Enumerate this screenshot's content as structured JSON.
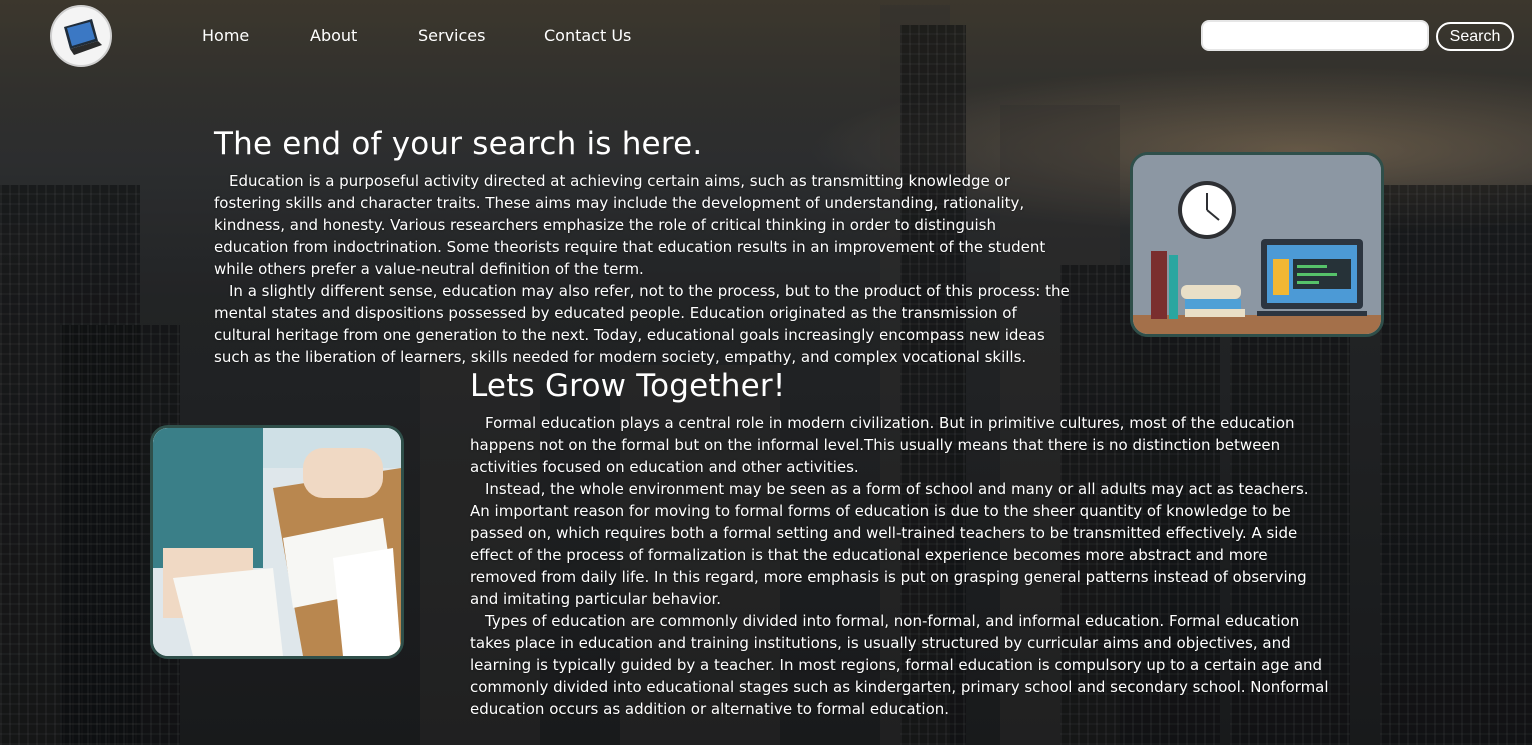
{
  "nav": {
    "logo_alt": "laptop logo",
    "items": [
      "Home",
      "About",
      "Services",
      "Contact Us"
    ]
  },
  "search": {
    "placeholder": "",
    "value": "",
    "button_label": "Search"
  },
  "section1": {
    "title": "The end of your search is here.",
    "paragraphs": [
      "Education is a purposeful activity directed at achieving certain aims, such as transmitting knowledge or fostering skills and character traits. These aims may include the development of understanding, rationality, kindness, and honesty. Various researchers emphasize the role of critical thinking in order to distinguish education from indoctrination. Some theorists require that education results in an improvement of the student while others prefer a value-neutral definition of the term.",
      "In a slightly different sense, education may also refer, not to the process, but to the product of this process: the mental states and dispositions possessed by educated people. Education originated as the transmission of cultural heritage from one generation to the next. Today, educational goals increasingly encompass new ideas such as the liberation of learners, skills needed for modern society, empathy, and complex vocational skills."
    ]
  },
  "section2": {
    "title": "Lets Grow Together!",
    "paragraphs": [
      "Formal education plays a central role in modern civilization. But in primitive cultures, most of the education happens not on the formal but on the informal level.This usually means that there is no distinction between activities focused on education and other activities.",
      "Instead, the whole environment may be seen as a form of school and many or all adults may act as teachers. An important reason for moving to formal forms of education is due to the sheer quantity of knowledge to be passed on, which requires both a formal setting and well-trained teachers to be transmitted effectively. A side effect of the process of formalization is that the educational experience becomes more abstract and more removed from daily life. In this regard, more emphasis is put on grasping general patterns instead of observing and imitating particular behavior.",
      "Types of education are commonly divided into formal, non-formal, and informal education. Formal education takes place in education and training institutions, is usually structured by curricular aims and objectives, and learning is typically guided by a teacher. In most regions, formal education is compulsory up to a certain age and commonly divided into educational stages such as kindergarten, primary school and secondary school. Nonformal education occurs as addition or alternative to formal education."
    ]
  },
  "colors": {
    "card_border": "#2f4f4a",
    "text": "#ffffff"
  },
  "icons": [
    "laptop-logo-icon",
    "desk-illustration",
    "study-photo"
  ]
}
